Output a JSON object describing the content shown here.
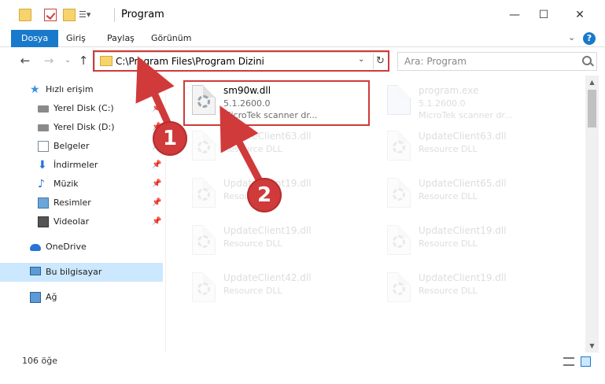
{
  "window": {
    "title": "Program",
    "min_symbol": "—",
    "max_symbol": "☐",
    "close_symbol": "✕"
  },
  "ribbon": {
    "tabs": [
      "Dosya",
      "Giriş",
      "Paylaş",
      "Görünüm"
    ],
    "expand_symbol": "⌄",
    "help_symbol": "?"
  },
  "nav": {
    "back_symbol": "←",
    "forward_symbol": "→",
    "recent_symbol": "⌄",
    "up_symbol": "↑",
    "address": "C:\\Program Files\\Program Dizini",
    "dropdown_symbol": "⌄",
    "refresh_symbol": "↻",
    "search_placeholder": "Ara: Program"
  },
  "sidebar": {
    "items": [
      {
        "label": "Hızlı erişim",
        "icon": "star-icon",
        "pinned": false
      },
      {
        "label": "Yerel Disk (C:)",
        "icon": "disk-icon",
        "pinned": true
      },
      {
        "label": "Yerel Disk (D:)",
        "icon": "disk-icon",
        "pinned": true
      },
      {
        "label": "Belgeler",
        "icon": "document-icon",
        "pinned": true
      },
      {
        "label": "İndirmeler",
        "icon": "download-icon",
        "pinned": true
      },
      {
        "label": "Müzik",
        "icon": "music-icon",
        "pinned": true
      },
      {
        "label": "Resimler",
        "icon": "pictures-icon",
        "pinned": true
      },
      {
        "label": "Videolar",
        "icon": "video-icon",
        "pinned": true
      },
      {
        "label": "OneDrive",
        "icon": "cloud-icon",
        "pinned": false
      },
      {
        "label": "Bu bilgisayar",
        "icon": "computer-icon",
        "pinned": false,
        "selected": true
      },
      {
        "label": "Ağ",
        "icon": "network-icon",
        "pinned": false
      }
    ],
    "pin_symbol": "📌"
  },
  "files": [
    {
      "name": "sm90w.dll",
      "version": "5.1.2600.0",
      "description": "MicroTek scanner dr...",
      "highlighted": true
    },
    {
      "name": "program.exe",
      "version": "5.1.2600.0",
      "description": "MicroTek scanner dr..."
    },
    {
      "name": "UpdateClient63.dll",
      "version": "Resource DLL",
      "description": ""
    },
    {
      "name": "UpdateClient63.dll",
      "version": "Resource DLL",
      "description": ""
    },
    {
      "name": "UpdateClient19.dll",
      "version": "Resource DLL",
      "description": ""
    },
    {
      "name": "UpdateClient65.dll",
      "version": "Resource DLL",
      "description": ""
    },
    {
      "name": "UpdateClient19.dll",
      "version": "Resource DLL",
      "description": ""
    },
    {
      "name": "UpdateClient19.dll",
      "version": "Resource DLL",
      "description": ""
    },
    {
      "name": "UpdateClient42.dll",
      "version": "Resource DLL",
      "description": ""
    },
    {
      "name": "UpdateClient19.dll",
      "version": "Resource DLL",
      "description": ""
    }
  ],
  "status": {
    "item_count": "106 öğe"
  },
  "annotations": {
    "callout_1": "1",
    "callout_2": "2",
    "color": "#d03a3a"
  },
  "colors": {
    "accent": "#1979ca",
    "selection": "#cce8ff"
  }
}
